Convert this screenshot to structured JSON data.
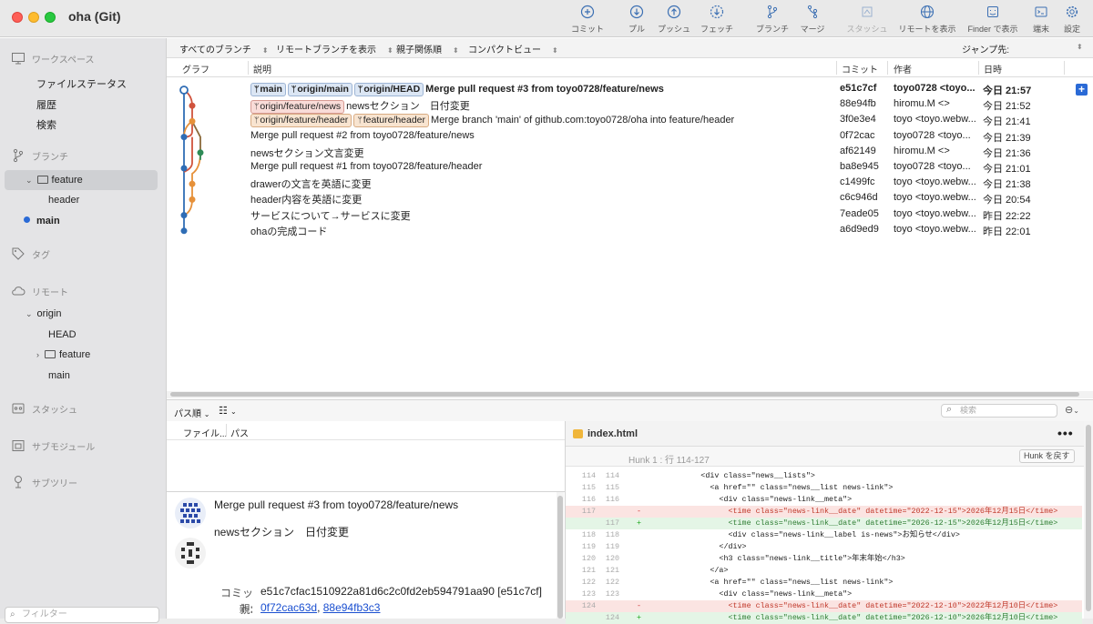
{
  "app": {
    "title": "oha (Git)"
  },
  "toolbar": [
    {
      "name": "commit",
      "label": "コミット",
      "disabled": false
    },
    {
      "name": "pull",
      "label": "プル",
      "disabled": false
    },
    {
      "name": "push",
      "label": "プッシュ",
      "disabled": false
    },
    {
      "name": "fetch",
      "label": "フェッチ",
      "disabled": false
    },
    {
      "name": "branch",
      "label": "ブランチ",
      "disabled": false
    },
    {
      "name": "merge",
      "label": "マージ",
      "disabled": false
    },
    {
      "name": "stash",
      "label": "スタッシュ",
      "disabled": true
    },
    {
      "name": "show-remote",
      "label": "リモートを表示",
      "disabled": false
    },
    {
      "name": "show-finder",
      "label": "Finder で表示",
      "disabled": false
    },
    {
      "name": "terminal",
      "label": "端末",
      "disabled": false
    },
    {
      "name": "settings",
      "label": "設定",
      "disabled": false
    }
  ],
  "sidebar": {
    "workspace": "ワークスペース",
    "file_status": "ファイルステータス",
    "history": "履歴",
    "search": "検索",
    "branches": "ブランチ",
    "branch_feature": "feature",
    "branch_header": "header",
    "branch_main": "main",
    "tags": "タグ",
    "remotes": "リモート",
    "remote_origin": "origin",
    "remote_head": "HEAD",
    "remote_feature": "feature",
    "remote_main": "main",
    "stashes": "スタッシュ",
    "submodules": "サブモジュール",
    "subtrees": "サブツリー",
    "filter_placeholder": "フィルター"
  },
  "filterbar": {
    "all_branches": "すべてのブランチ",
    "show_remote": "リモートブランチを表示",
    "ancestor_order": "親子関係順",
    "compact_view": "コンパクトビュー",
    "jump_to": "ジャンプ先:"
  },
  "columns": {
    "graph": "グラフ",
    "description": "説明",
    "commit": "コミット",
    "author": "作者",
    "date": "日時"
  },
  "commits": [
    {
      "tags": [
        {
          "text": "main",
          "style": "local"
        },
        {
          "text": "origin/main",
          "style": "local"
        },
        {
          "text": "origin/HEAD",
          "style": "local"
        }
      ],
      "desc": "Merge pull request #3 from toyo0728/feature/news",
      "hash": "e51c7cf",
      "author": "toyo0728 <toyo...",
      "date": "今日 21:57",
      "bold": true
    },
    {
      "tags": [
        {
          "text": "origin/feature/news",
          "style": "red"
        }
      ],
      "desc": "newsセクション　日付変更",
      "hash": "88e94fb",
      "author": "hiromu.M <>",
      "date": "今日 21:52",
      "bold": false
    },
    {
      "tags": [
        {
          "text": "origin/feature/header",
          "style": "orange"
        },
        {
          "text": "feature/header",
          "style": "orange"
        }
      ],
      "desc": "Merge branch 'main' of github.com:toyo0728/oha into feature/header",
      "hash": "3f0e3e4",
      "author": "toyo <toyo.webw...",
      "date": "今日 21:41",
      "bold": false
    },
    {
      "tags": [],
      "desc": "Merge pull request #2 from toyo0728/feature/news",
      "hash": "0f72cac",
      "author": "toyo0728 <toyo...",
      "date": "今日 21:39",
      "bold": false
    },
    {
      "tags": [],
      "desc": "newsセクション文言変更",
      "hash": "af62149",
      "author": "hiromu.M <>",
      "date": "今日 21:36",
      "bold": false
    },
    {
      "tags": [],
      "desc": "Merge pull request #1 from toyo0728/feature/header",
      "hash": "ba8e945",
      "author": "toyo0728 <toyo...",
      "date": "今日 21:01",
      "bold": false
    },
    {
      "tags": [],
      "desc": "drawerの文言を英語に変更",
      "hash": "c1499fc",
      "author": "toyo <toyo.webw...",
      "date": "今日 21:38",
      "bold": false
    },
    {
      "tags": [],
      "desc": "header内容を英語に変更",
      "hash": "c6c946d",
      "author": "toyo <toyo.webw...",
      "date": "今日 20:54",
      "bold": false
    },
    {
      "tags": [],
      "desc": "サービスについて→サービスに変更",
      "hash": "7eade05",
      "author": "toyo <toyo.webw...",
      "date": "昨日 22:22",
      "bold": false
    },
    {
      "tags": [],
      "desc": "ohaの完成コード",
      "hash": "a6d9ed9",
      "author": "toyo <toyo.webw...",
      "date": "昨日 22:01",
      "bold": false
    }
  ],
  "bottom": {
    "path_order": "パス順",
    "search_placeholder": "検索",
    "file_col": "ファイル...",
    "path_col": "パス"
  },
  "commit_detail": {
    "subject": "Merge pull request #3 from toyo0728/feature/news",
    "body": "newsセクション　日付変更",
    "commit_label": "コミット:",
    "commit_value": "e51c7cfac1510922a81d6c2c0fd2eb594791aa90 [e51c7cf]",
    "parents_label": "親:",
    "parent1": "0f72cac63d",
    "parent2": "88e94fb3c3"
  },
  "diff": {
    "filename": "index.html",
    "hunk_title": "Hunk 1 : 行 114-127",
    "revert_hunk": "Hunk を戻す",
    "lines": [
      {
        "o": "114",
        "n": "114",
        "t": "ctx",
        "c": "            <div class=\"news__lists\">"
      },
      {
        "o": "115",
        "n": "115",
        "t": "ctx",
        "c": "              <a href=\"\" class=\"news__list news-link\">"
      },
      {
        "o": "116",
        "n": "116",
        "t": "ctx",
        "c": "                <div class=\"news-link__meta\">"
      },
      {
        "o": "117",
        "n": "",
        "t": "del",
        "c": "                  <time class=\"news-link__date\" datetime=\"2022-12-15\">2026年12月15日</time>"
      },
      {
        "o": "",
        "n": "117",
        "t": "add",
        "c": "                  <time class=\"news-link__date\" datetime=\"2026-12-15\">2026年12月15日</time>"
      },
      {
        "o": "118",
        "n": "118",
        "t": "ctx",
        "c": "                  <div class=\"news-link__label is-news\">お知らせ</div>"
      },
      {
        "o": "119",
        "n": "119",
        "t": "ctx",
        "c": "                </div>"
      },
      {
        "o": "120",
        "n": "120",
        "t": "ctx",
        "c": "                <h3 class=\"news-link__title\">年末年始</h3>"
      },
      {
        "o": "121",
        "n": "121",
        "t": "ctx",
        "c": "              </a>"
      },
      {
        "o": "122",
        "n": "122",
        "t": "ctx",
        "c": "              <a href=\"\" class=\"news__list news-link\">"
      },
      {
        "o": "123",
        "n": "123",
        "t": "ctx",
        "c": "                <div class=\"news-link__meta\">"
      },
      {
        "o": "124",
        "n": "",
        "t": "del",
        "c": "                  <time class=\"news-link__date\" datetime=\"2022-12-10\">2022年12月10日</time>"
      },
      {
        "o": "",
        "n": "124",
        "t": "add",
        "c": "                  <time class=\"news-link__date\" datetime=\"2026-12-10\">2026年12月10日</time>"
      }
    ]
  },
  "colors": {
    "accent": "#2a6ad6",
    "graph_blue": "#2f6db5",
    "graph_red": "#d0533d",
    "graph_orange": "#e6913a",
    "graph_green": "#2e8b57",
    "graph_brown": "#8a6a3a"
  }
}
